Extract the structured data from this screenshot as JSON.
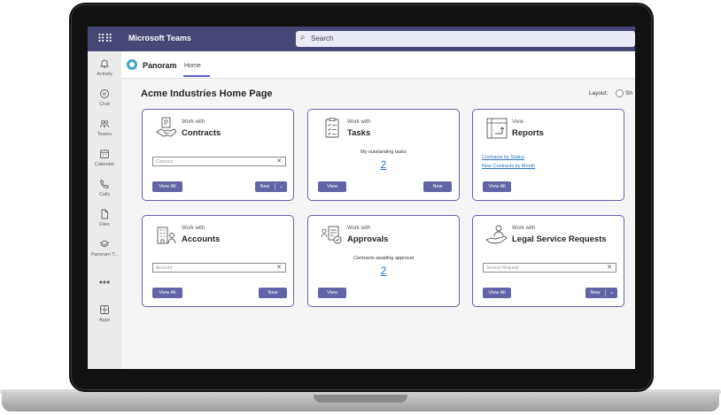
{
  "window": {
    "app_title": "Microsoft Teams",
    "search_placeholder": "Search"
  },
  "rail": [
    {
      "label": "Activity",
      "icon": "bell-icon"
    },
    {
      "label": "Chat",
      "icon": "chat-icon"
    },
    {
      "label": "Teams",
      "icon": "teams-icon"
    },
    {
      "label": "Calendar",
      "icon": "calendar-icon"
    },
    {
      "label": "Calls",
      "icon": "phone-icon"
    },
    {
      "label": "Files",
      "icon": "file-icon"
    },
    {
      "label": "Panoram T...",
      "icon": "panoram-icon"
    },
    {
      "label": "",
      "icon": "more-icon"
    },
    {
      "label": "Apps",
      "icon": "apps-icon"
    }
  ],
  "app": {
    "name": "Panoram",
    "tab": "Home"
  },
  "page": {
    "title": "Acme Industries Home Page",
    "layout_label": "Layout:",
    "layout_option": "Sh"
  },
  "cards": {
    "contracts": {
      "pre": "Work with",
      "title": "Contracts",
      "input_placeholder": "Contract",
      "clear": "✕",
      "btn_view_all": "View All",
      "btn_new": "New",
      "chevron": "⌄"
    },
    "tasks": {
      "pre": "Work with",
      "title": "Tasks",
      "subtext": "My outstanding tasks",
      "count": "2",
      "btn_view": "View",
      "btn_new": "New"
    },
    "reports": {
      "pre": "View",
      "title": "Reports",
      "link1": "Contracts by Status",
      "link2": "New Contracts by Month",
      "btn_view_all": "View All"
    },
    "accounts": {
      "pre": "Work with",
      "title": "Accounts",
      "input_placeholder": "Account",
      "clear": "✕",
      "btn_view_all": "View All",
      "btn_new": "New"
    },
    "approvals": {
      "pre": "Work with",
      "title": "Approvals",
      "subtext": "Contracts awaiting approval",
      "count": "2",
      "btn_view": "View"
    },
    "legal": {
      "pre": "Work with",
      "title": "Legal Service Requests",
      "input_placeholder": "Service Request",
      "clear": "✕",
      "btn_view_all": "View All",
      "btn_new": "New",
      "chevron": "⌄"
    }
  },
  "colors": {
    "brand": "#464775",
    "accent": "#6264a7",
    "link": "#2c6fc6"
  }
}
